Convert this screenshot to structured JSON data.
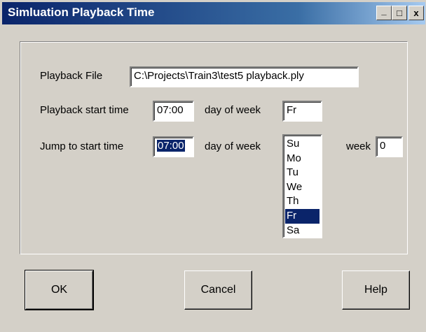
{
  "window": {
    "title": "Simluation Playback Time",
    "controls": {
      "minimize": "_",
      "maximize": "□",
      "close": "x"
    }
  },
  "form": {
    "playback_file_label": "Playback File",
    "playback_file_value": "C:\\Projects\\Train3\\test5 playback.ply",
    "playback_start_label": "Playback start time",
    "playback_start_value": "07:00",
    "playback_dow_label": "day of week",
    "playback_dow_value": "Fr",
    "jump_start_label": "Jump to start time",
    "jump_start_value": "07:00",
    "jump_dow_label": "day of week",
    "day_options": [
      "Su",
      "Mo",
      "Tu",
      "We",
      "Th",
      "Fr",
      "Sa"
    ],
    "selected_day": "Fr",
    "week_label": "week",
    "week_value": "0"
  },
  "buttons": {
    "ok": "OK",
    "cancel": "Cancel",
    "help": "Help"
  },
  "colors": {
    "title_bar": "#0a246a",
    "selection": "#0a246a",
    "face": "#d4d0c8"
  }
}
